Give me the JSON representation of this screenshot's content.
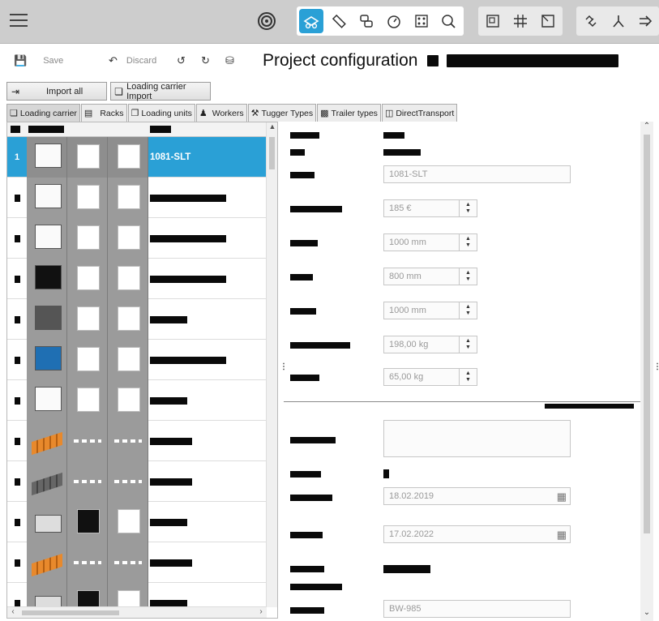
{
  "toolbar": {
    "left_group_icons": [
      "radar-icon"
    ],
    "main_group_icons": [
      "loading-carrier-view-icon",
      "ruler-icon",
      "links-icon",
      "timer-icon",
      "dots-grid-icon",
      "zoom-icon"
    ],
    "layout_group_icons": [
      "layout-frame-icon",
      "grid-icon",
      "resize-frame-icon"
    ],
    "right_group_icons": [
      "chain-icon",
      "fork-icon",
      "arrow-forward-icon"
    ],
    "colors": {
      "active": "#2aa0d6",
      "toolbar_bg": "#cdcdcd"
    }
  },
  "actions": {
    "save_label": "Save",
    "discard_label": "Discard"
  },
  "project": {
    "title": "Project configuration"
  },
  "buttons": {
    "import_all": "Import all",
    "loading_carrier_import": "Loading carrier Import"
  },
  "tabs": [
    {
      "label": "Loading carrier",
      "icon": "box-icon"
    },
    {
      "label": "Racks",
      "icon": "rack-icon"
    },
    {
      "label": "Loading units",
      "icon": "units-icon"
    },
    {
      "label": "Workers",
      "icon": "worker-icon"
    },
    {
      "label": "Tugger Types",
      "icon": "tugger-icon"
    },
    {
      "label": "Trailer types",
      "icon": "trailer-icon"
    },
    {
      "label": "DirectTransport",
      "icon": "transport-icon"
    }
  ],
  "grid": {
    "rows": [
      {
        "no": "1",
        "name": "1081-SLT",
        "selected": true,
        "kind": "box-white"
      },
      {
        "no": "",
        "name": "",
        "kind": "box-white"
      },
      {
        "no": "",
        "name": "",
        "kind": "box-white"
      },
      {
        "no": "",
        "name": "",
        "kind": "box-black"
      },
      {
        "no": "",
        "name": "",
        "kind": "box-grey"
      },
      {
        "no": "",
        "name": "",
        "kind": "box-blue-pallet"
      },
      {
        "no": "",
        "name": "",
        "kind": "box-white"
      },
      {
        "no": "",
        "name": "",
        "kind": "pallet-orange"
      },
      {
        "no": "",
        "name": "",
        "kind": "pallet-grey"
      },
      {
        "no": "",
        "name": "",
        "kind": "crate-open"
      },
      {
        "no": "",
        "name": "",
        "kind": "pallet-orange"
      },
      {
        "no": "",
        "name": "",
        "kind": "crate-open"
      }
    ]
  },
  "detail": {
    "name_value": "1081-SLT",
    "fields": [
      {
        "value": "185 €"
      },
      {
        "value": "1000 mm"
      },
      {
        "value": "800 mm"
      },
      {
        "value": "1000 mm"
      },
      {
        "value": "198,00 kg"
      },
      {
        "value": "65,00 kg"
      }
    ],
    "valid_from": "18.02.2019",
    "valid_to": "17.02.2022",
    "supplier": "BW-985"
  }
}
